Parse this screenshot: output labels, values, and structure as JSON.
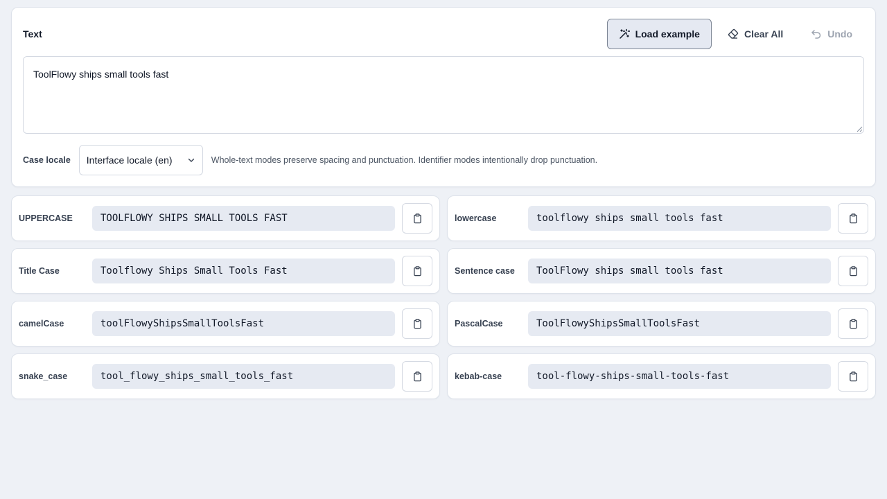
{
  "input": {
    "label": "Text",
    "value": "ToolFlowy ships small tools fast"
  },
  "toolbar": {
    "load_example": "Load example",
    "clear_all": "Clear All",
    "undo": "Undo"
  },
  "locale": {
    "label": "Case locale",
    "selected": "Interface locale (en)",
    "hint": "Whole-text modes preserve spacing and punctuation. Identifier modes intentionally drop punctuation."
  },
  "results": [
    {
      "label": "UPPERCASE",
      "value": "TOOLFLOWY SHIPS SMALL TOOLS FAST"
    },
    {
      "label": "lowercase",
      "value": "toolflowy ships small tools fast"
    },
    {
      "label": "Title Case",
      "value": "Toolflowy Ships Small Tools Fast"
    },
    {
      "label": "Sentence case",
      "value": "ToolFlowy ships small tools fast"
    },
    {
      "label": "camelCase",
      "value": "toolFlowyShipsSmallToolsFast"
    },
    {
      "label": "PascalCase",
      "value": "ToolFlowyShipsSmallToolsFast"
    },
    {
      "label": "snake_case",
      "value": "tool_flowy_ships_small_tools_fast"
    },
    {
      "label": "kebab-case",
      "value": "tool-flowy-ships-small-tools-fast"
    }
  ],
  "icons": {
    "load_example": "magic-wand-icon",
    "clear_all": "eraser-icon",
    "undo": "undo-icon",
    "copy": "clipboard-icon",
    "select": "chevron-down-icon"
  },
  "colors": {
    "background": "#eef1f6",
    "panel": "#ffffff",
    "value_bg": "#e6eaf2",
    "primary_button_bg": "#e5e9f2",
    "disabled_text": "#9ca3af"
  }
}
